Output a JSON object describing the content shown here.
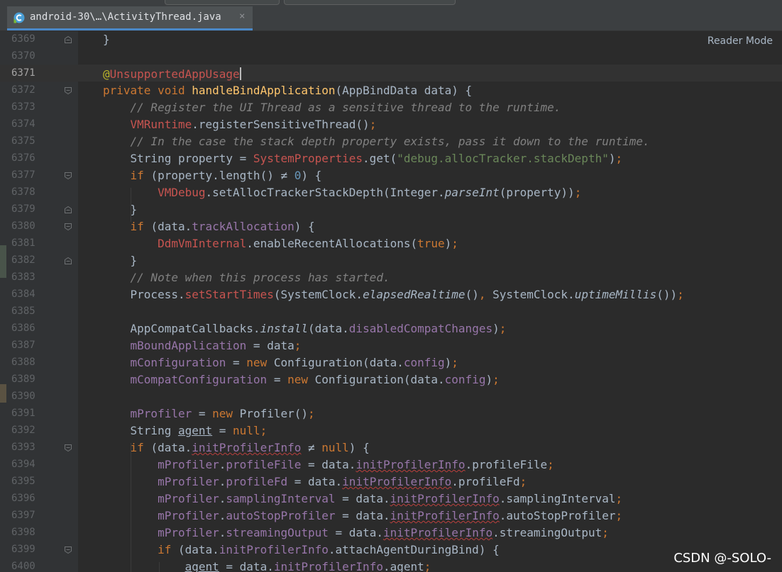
{
  "tab": {
    "title": "android-30\\…\\ActivityThread.java",
    "close": "×",
    "icon": "java-class-icon"
  },
  "reader_mode_label": "Reader Mode",
  "watermark": "CSDN @-SOLO-",
  "colors": {
    "background": "#2b2b2b",
    "gutter": "#313335",
    "keyword": "#cc7832",
    "comment": "#808080",
    "string": "#6a8759",
    "number": "#6897bb",
    "field": "#9876aa",
    "method_decl": "#ffc66d",
    "unresolved_class": "#c75450",
    "annotation": "#bbb529",
    "text": "#a9b7c6",
    "tab_underline": "#4a88c7"
  },
  "lines": [
    {
      "n": "6369",
      "t": [
        [
          "}"
        ]
      ]
    },
    {
      "n": "6370",
      "t": []
    },
    {
      "n": "6371",
      "t": [
        [
          "@",
          "ann"
        ],
        [
          "UnsupportedAppUsage",
          "cls"
        ]
      ]
    },
    {
      "n": "6372",
      "t": [
        [
          "private void ",
          "kw"
        ],
        [
          "handleBindApplication",
          "fn"
        ],
        [
          "(AppBindData data) {"
        ]
      ]
    },
    {
      "n": "6373",
      "t": [
        [
          "    "
        ],
        [
          "// Register the UI Thread as a sensitive thread to the runtime.",
          "cm"
        ]
      ]
    },
    {
      "n": "6374",
      "t": [
        [
          "    "
        ],
        [
          "VMRuntime",
          "cls"
        ],
        [
          ".registerSensitiveThread()"
        ],
        [
          ";",
          "kw"
        ]
      ]
    },
    {
      "n": "6375",
      "t": [
        [
          "    "
        ],
        [
          "// In the case the stack depth property exists, pass it down to the runtime.",
          "cm"
        ]
      ]
    },
    {
      "n": "6376",
      "t": [
        [
          "    String property = "
        ],
        [
          "SystemProperties",
          "cls"
        ],
        [
          ".get("
        ],
        [
          "\"debug.allocTracker.stackDepth\"",
          "str"
        ],
        [
          ")"
        ],
        [
          ";",
          "kw"
        ]
      ]
    },
    {
      "n": "6377",
      "t": [
        [
          "    "
        ],
        [
          "if ",
          "kw"
        ],
        [
          "(property.length() ≠ "
        ],
        [
          "0",
          "num"
        ],
        [
          ") {"
        ]
      ]
    },
    {
      "n": "6378",
      "t": [
        [
          "        "
        ],
        [
          "VMDebug",
          "cls"
        ],
        [
          ".setAllocTrackerStackDepth(Integer."
        ],
        [
          "parseInt",
          "it"
        ],
        [
          "(property))"
        ],
        [
          ";",
          "kw"
        ]
      ]
    },
    {
      "n": "6379",
      "t": [
        [
          "    }"
        ]
      ]
    },
    {
      "n": "6380",
      "t": [
        [
          "    "
        ],
        [
          "if ",
          "kw"
        ],
        [
          "(data."
        ],
        [
          "trackAllocation",
          "fld"
        ],
        [
          ") {"
        ]
      ]
    },
    {
      "n": "6381",
      "t": [
        [
          "        "
        ],
        [
          "DdmVmInternal",
          "cls"
        ],
        [
          ".enableRecentAllocations("
        ],
        [
          "true",
          "kw"
        ],
        [
          ")"
        ],
        [
          ";",
          "kw"
        ]
      ]
    },
    {
      "n": "6382",
      "t": [
        [
          "    }"
        ]
      ]
    },
    {
      "n": "6383",
      "t": [
        [
          "    "
        ],
        [
          "// Note when this process has started.",
          "cm"
        ]
      ]
    },
    {
      "n": "6384",
      "t": [
        [
          "    Process."
        ],
        [
          "setStartTimes",
          "cls"
        ],
        [
          "(SystemClock."
        ],
        [
          "elapsedRealtime",
          "it"
        ],
        [
          "()"
        ],
        [
          ", ",
          "kw"
        ],
        [
          "SystemClock."
        ],
        [
          "uptimeMillis",
          "it"
        ],
        [
          "())"
        ],
        [
          ";",
          "kw"
        ]
      ]
    },
    {
      "n": "6385",
      "t": []
    },
    {
      "n": "6386",
      "t": [
        [
          "    AppCompatCallbacks."
        ],
        [
          "install",
          "it"
        ],
        [
          "(data."
        ],
        [
          "disabledCompatChanges",
          "fld"
        ],
        [
          ")"
        ],
        [
          ";",
          "kw"
        ]
      ]
    },
    {
      "n": "6387",
      "t": [
        [
          "    "
        ],
        [
          "mBoundApplication",
          "fld"
        ],
        [
          " = data"
        ],
        [
          ";",
          "kw"
        ]
      ]
    },
    {
      "n": "6388",
      "t": [
        [
          "    "
        ],
        [
          "mConfiguration",
          "fld"
        ],
        [
          " = "
        ],
        [
          "new ",
          "kw"
        ],
        [
          "Configuration(data."
        ],
        [
          "config",
          "fld"
        ],
        [
          ")"
        ],
        [
          ";",
          "kw"
        ]
      ]
    },
    {
      "n": "6389",
      "t": [
        [
          "    "
        ],
        [
          "mCompatConfiguration",
          "fld"
        ],
        [
          " = "
        ],
        [
          "new ",
          "kw"
        ],
        [
          "Configuration(data."
        ],
        [
          "config",
          "fld"
        ],
        [
          ")"
        ],
        [
          ";",
          "kw"
        ]
      ]
    },
    {
      "n": "6390",
      "t": []
    },
    {
      "n": "6391",
      "t": [
        [
          "    "
        ],
        [
          "mProfiler",
          "fld"
        ],
        [
          " = "
        ],
        [
          "new ",
          "kw"
        ],
        [
          "Profiler()"
        ],
        [
          ";",
          "kw"
        ]
      ]
    },
    {
      "n": "6392",
      "t": [
        [
          "    String "
        ],
        [
          "agent",
          "uline"
        ],
        [
          " = "
        ],
        [
          "null",
          "kw"
        ],
        [
          ";",
          "kw"
        ]
      ]
    },
    {
      "n": "6393",
      "t": [
        [
          "    "
        ],
        [
          "if ",
          "kw"
        ],
        [
          "(data."
        ],
        [
          "initProfilerInfo",
          "fld sq"
        ],
        [
          " ≠ "
        ],
        [
          "null",
          "kw"
        ],
        [
          ") {"
        ]
      ]
    },
    {
      "n": "6394",
      "t": [
        [
          "        "
        ],
        [
          "mProfiler",
          "fld"
        ],
        [
          "."
        ],
        [
          "profileFile",
          "fld"
        ],
        [
          " = data."
        ],
        [
          "initProfilerInfo",
          "fld sq"
        ],
        [
          ".profileFile"
        ],
        [
          ";",
          "kw"
        ]
      ]
    },
    {
      "n": "6395",
      "t": [
        [
          "        "
        ],
        [
          "mProfiler",
          "fld"
        ],
        [
          "."
        ],
        [
          "profileFd",
          "fld"
        ],
        [
          " = data."
        ],
        [
          "initProfilerInfo",
          "fld sq"
        ],
        [
          ".profileFd"
        ],
        [
          ";",
          "kw"
        ]
      ]
    },
    {
      "n": "6396",
      "t": [
        [
          "        "
        ],
        [
          "mProfiler",
          "fld"
        ],
        [
          "."
        ],
        [
          "samplingInterval",
          "fld"
        ],
        [
          " = data."
        ],
        [
          "initProfilerInfo",
          "fld sq"
        ],
        [
          ".samplingInterval"
        ],
        [
          ";",
          "kw"
        ]
      ]
    },
    {
      "n": "6397",
      "t": [
        [
          "        "
        ],
        [
          "mProfiler",
          "fld"
        ],
        [
          "."
        ],
        [
          "autoStopProfiler",
          "fld"
        ],
        [
          " = data."
        ],
        [
          "initProfilerInfo",
          "fld sq"
        ],
        [
          ".autoStopProfiler"
        ],
        [
          ";",
          "kw"
        ]
      ]
    },
    {
      "n": "6398",
      "t": [
        [
          "        "
        ],
        [
          "mProfiler",
          "fld"
        ],
        [
          "."
        ],
        [
          "streamingOutput",
          "fld"
        ],
        [
          " = data."
        ],
        [
          "initProfilerInfo",
          "fld sq"
        ],
        [
          ".streamingOutput"
        ],
        [
          ";",
          "kw"
        ]
      ]
    },
    {
      "n": "6399",
      "t": [
        [
          "        "
        ],
        [
          "if ",
          "kw"
        ],
        [
          "(data."
        ],
        [
          "initProfilerInfo",
          "fld"
        ],
        [
          ".attachAgentDuringBind) {"
        ]
      ]
    },
    {
      "n": "6400",
      "t": [
        [
          "            "
        ],
        [
          "agent",
          "uline"
        ],
        [
          " = data."
        ],
        [
          "initProfilerInfo",
          "fld sq"
        ],
        [
          ".agent"
        ],
        [
          ";",
          "kw"
        ]
      ]
    }
  ]
}
